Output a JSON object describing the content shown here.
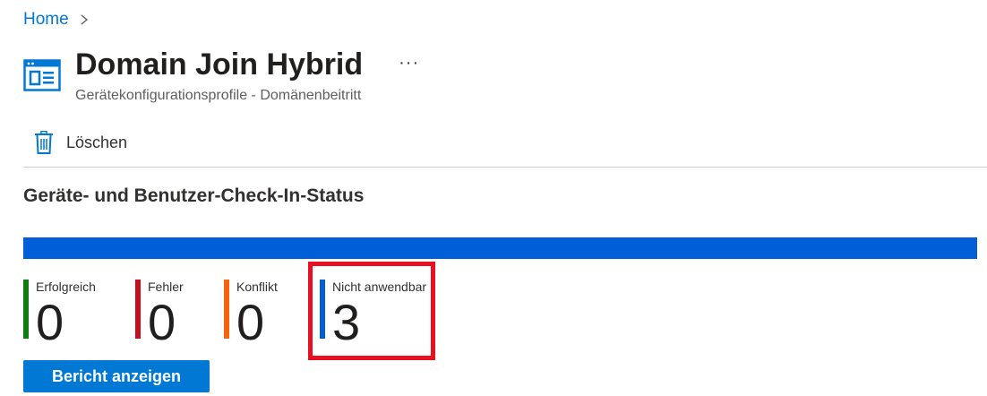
{
  "breadcrumb": {
    "home": "Home"
  },
  "header": {
    "title": "Domain Join Hybrid",
    "subtitle": "Gerätekonfigurationsprofile - Domänenbeitritt",
    "more": "···"
  },
  "toolbar": {
    "delete_label": "Löschen"
  },
  "section": {
    "title": "Geräte- und Benutzer-Check-In-Status"
  },
  "status_bar": {
    "color": "#005ed9",
    "fill": 1.0
  },
  "stats": [
    {
      "label": "Erfolgreich",
      "value": "0",
      "color": "#107c10"
    },
    {
      "label": "Fehler",
      "value": "0",
      "color": "#c50f1f"
    },
    {
      "label": "Konflikt",
      "value": "0",
      "color": "#f7630c"
    },
    {
      "label": "Nicht anwendbar",
      "value": "3",
      "color": "#005ed9"
    }
  ],
  "highlight_color": "#e81123",
  "report_button": {
    "label": "Bericht anzeigen"
  },
  "icons": {
    "page": "profile-window-icon",
    "delete": "trash-icon",
    "breadcrumb_sep": "chevron-right-icon"
  }
}
